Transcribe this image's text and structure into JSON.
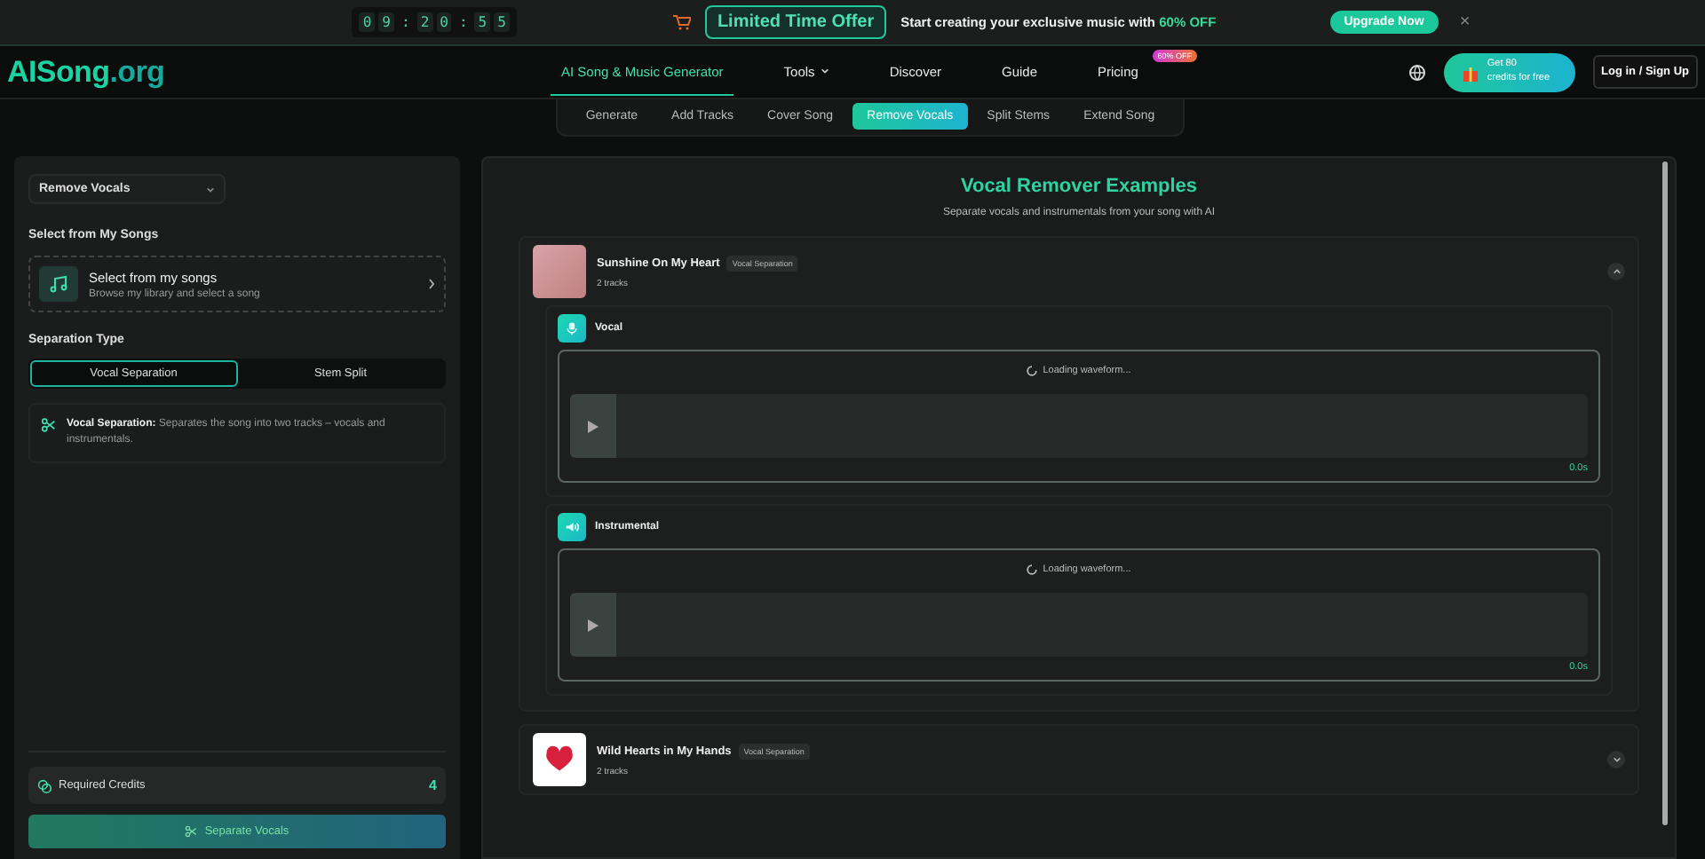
{
  "promo_bar": {
    "timer": [
      "0",
      "9",
      ":",
      "2",
      "0",
      ":",
      "5",
      "5"
    ],
    "offer_label": "Limited Time Offer",
    "message": "Start creating your exclusive music with",
    "highlight": "60% OFF",
    "upgrade_button": "Upgrade Now",
    "close": "×"
  },
  "nav": {
    "logo_main": "AISong",
    "logo_suffix": ".org",
    "items": [
      {
        "label": "AI Song & Music Generator",
        "selected": true,
        "kind": "link"
      },
      {
        "label": "Tools",
        "selected": false,
        "kind": "dropdown"
      },
      {
        "label": "Discover",
        "selected": false,
        "kind": "link"
      },
      {
        "label": "Guide",
        "selected": false,
        "kind": "link"
      },
      {
        "label": "Pricing",
        "selected": false,
        "kind": "badge",
        "badge": "60% OFF"
      }
    ],
    "credits_promo": [
      "Get 80",
      "credits for free"
    ],
    "login": "Log in / Sign Up"
  },
  "sub_tabs": [
    {
      "label": "Generate",
      "selected": false
    },
    {
      "label": "Add Tracks",
      "selected": false
    },
    {
      "label": "Cover Song",
      "selected": false
    },
    {
      "label": "Remove Vocals",
      "selected": true
    },
    {
      "label": "Split Stems",
      "selected": false
    },
    {
      "label": "Extend Song",
      "selected": false
    }
  ],
  "left_panel": {
    "mode_select": "Remove Vocals",
    "songs_heading": "Select from My Songs",
    "song_picker": {
      "title": "Select from my songs",
      "subtitle": "Browse my library and select a song"
    },
    "separation_heading": "Separation Type",
    "separation_options": [
      {
        "label": "Vocal Separation",
        "selected": true
      },
      {
        "label": "Stem Split",
        "selected": false
      }
    ],
    "info": "**Vocal Separation:** Separates the song into two tracks – vocals and instrumentals.",
    "credits_label": "Required Credits",
    "credits_value": "4",
    "submit": "Separate Vocals"
  },
  "examples": {
    "title": "Vocal Remover Examples",
    "subtitle": "Separate vocals and instrumentals from your song with AI",
    "songs": [
      {
        "title": "Sunshine On My Heart",
        "tag": "Vocal Separation",
        "tracks_count": "2 tracks",
        "expanded": true,
        "kind": "photo",
        "tracks": [
          {
            "name": "Vocal",
            "kind": "vocal",
            "loading": "Loading waveform...",
            "time": "0.0s"
          },
          {
            "name": "Instrumental",
            "kind": "instrumental",
            "loading": "Loading waveform...",
            "time": "0.0s"
          }
        ]
      },
      {
        "title": "Wild Hearts in My Hands",
        "tag": "Vocal Separation",
        "tracks_count": "2 tracks",
        "expanded": false,
        "kind": "heart"
      }
    ]
  }
}
